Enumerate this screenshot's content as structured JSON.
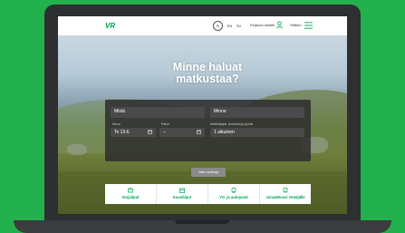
{
  "nav": {
    "logo": "VR",
    "languages": [
      "FI",
      "EN",
      "SV"
    ],
    "login_label": "Kirjaudu sisään",
    "menu_label": "Valikko"
  },
  "hero": {
    "headline_line1": "Minne haluat",
    "headline_line2": "matkustaa?"
  },
  "search": {
    "from_placeholder": "Mistä",
    "to_placeholder": "Minne",
    "when_label": "Meno",
    "return_label": "Paluu",
    "passengers_label": "Matkustajat, lemmikit ja pyörät",
    "date_value": "To 13.6.",
    "return_value": "–",
    "passengers_value": "1 aikuinen",
    "search_button": "Hae matkoja"
  },
  "quick_links": [
    {
      "label": "Sarjaliput",
      "icon": "ticket-stack-icon"
    },
    {
      "label": "Kausiliput",
      "icon": "calendar-ticket-icon"
    },
    {
      "label": "Yö- ja autojunat",
      "icon": "train-icon"
    },
    {
      "label": "Juna&Bussi Venäjälle",
      "icon": "train-bus-icon"
    }
  ],
  "colors": {
    "background": "#22b14c",
    "brand": "#00a651",
    "panel": "#2d2d2d"
  }
}
